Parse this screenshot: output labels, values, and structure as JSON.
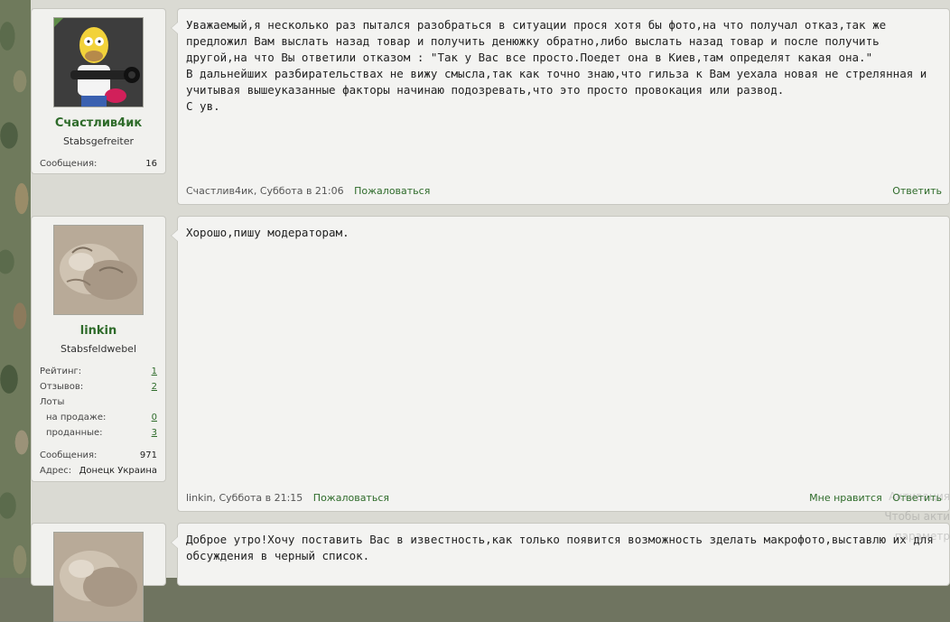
{
  "posts": [
    {
      "user": {
        "name": "Счастлив4ик",
        "title": "Stabsgefreiter",
        "stats": [
          {
            "label": "Сообщения:",
            "value": "16"
          }
        ]
      },
      "text": "Уважаемый,я несколько раз пытался разобраться в ситуации прося хотя бы фото,на что получал отказ,так же\nпредложил Вам выслать назад товар и получить денюжку обратно,либо выслать назад товар и после получить\nдругой,на что Вы ответили отказом : \"Так у Вас все просто.Поедет она в Киев,там определят какая она.\"\nВ дальнейших разбирательствах не вижу смысла,так как точно знаю,что гильза к Вам уехала новая не стрелянная и\nучитывая вышеуказанные факторы начинаю подозревать,что это просто провокация или развод.\nС ув.",
      "meta": "Счастлив4ик, Суббота в 21:06",
      "report": "Пожаловаться",
      "reply": "Ответить"
    },
    {
      "user": {
        "name": "linkin",
        "title": "Stabsfeldwebel",
        "ratings": [
          {
            "label": "Рейтинг:",
            "value": "1"
          },
          {
            "label": "Отзывов:",
            "value": "2"
          }
        ],
        "lots_label": "Лоты",
        "lots": [
          {
            "label": "на продаже:",
            "value": "0"
          },
          {
            "label": "проданные:",
            "value": "3"
          }
        ],
        "messages_label": "Сообщения:",
        "messages": "971",
        "address_label": "Адрес:",
        "address": "Донецк Украина"
      },
      "text": "Хорошо,пишу модераторам.",
      "meta": "linkin, Суббота в 21:15",
      "report": "Пожаловаться",
      "like": "Мне нравится",
      "reply": "Ответить"
    },
    {
      "text": "Доброе утро!Хочу поставить Вас в известность,как только появится возможность зделать макрофото,выставлю их для\nобсуждения в черный список."
    }
  ],
  "watermark": [
    "Активация",
    "Чтобы акти",
    "параметр"
  ]
}
